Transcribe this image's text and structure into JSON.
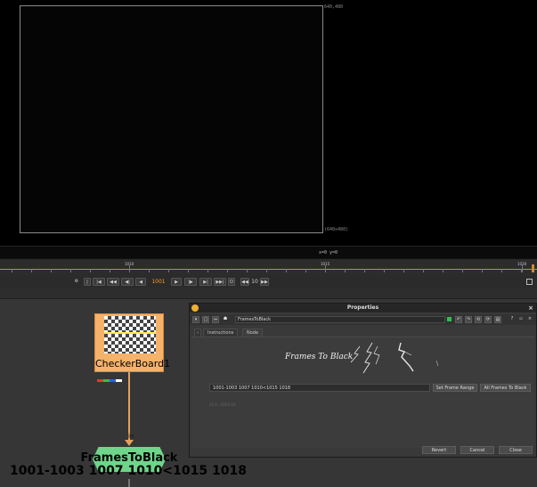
{
  "viewer": {
    "format_top": "640,480",
    "format_bottom": "(640x480)",
    "coords": "x=0 y=0"
  },
  "timeline": {
    "ticks": [
      {
        "label": "1010"
      },
      {
        "label": "1015"
      },
      {
        "label": "1020"
      }
    ]
  },
  "transport": {
    "current_frame": "1001",
    "increment": "10",
    "buttons": {
      "prev_key": "|◀",
      "prev_inc": "◀◀",
      "prev_frame": "◀|",
      "play_back": "◀",
      "play_fwd": "▶",
      "next_frame": "|▶",
      "next_key": "▶|",
      "last": "▶▶|",
      "loop": "O",
      "dec": "◀◀",
      "inc": "▶▶",
      "first": "|"
    }
  },
  "nodes": {
    "checker": {
      "label": "CheckerBoard1",
      "input_label": "in"
    },
    "ftb": {
      "title": "FramesToBlack",
      "frames": "1001-1003 1007 1010<1015 1018"
    }
  },
  "properties": {
    "title": "Properties",
    "close": "×",
    "node_name": "FramesToBlack",
    "tabs": {
      "instructions": "Instructions",
      "node": "Node"
    },
    "logo_text": "Frames To Black",
    "frames_value": "1001-1003 1007 1010<1015 1018",
    "set_range": "Set Frame Range",
    "all_frames": "All Frames To Black",
    "version": "v1.0 - 2024-10",
    "footer": {
      "revert": "Revert",
      "cancel": "Cancel",
      "close": "Close"
    }
  },
  "colors": {
    "timeline_accent": "#d38b22",
    "frame_number": "#ff9a2a",
    "checker_node": "#f5b26a",
    "ftb_node": "#6fd58a"
  }
}
